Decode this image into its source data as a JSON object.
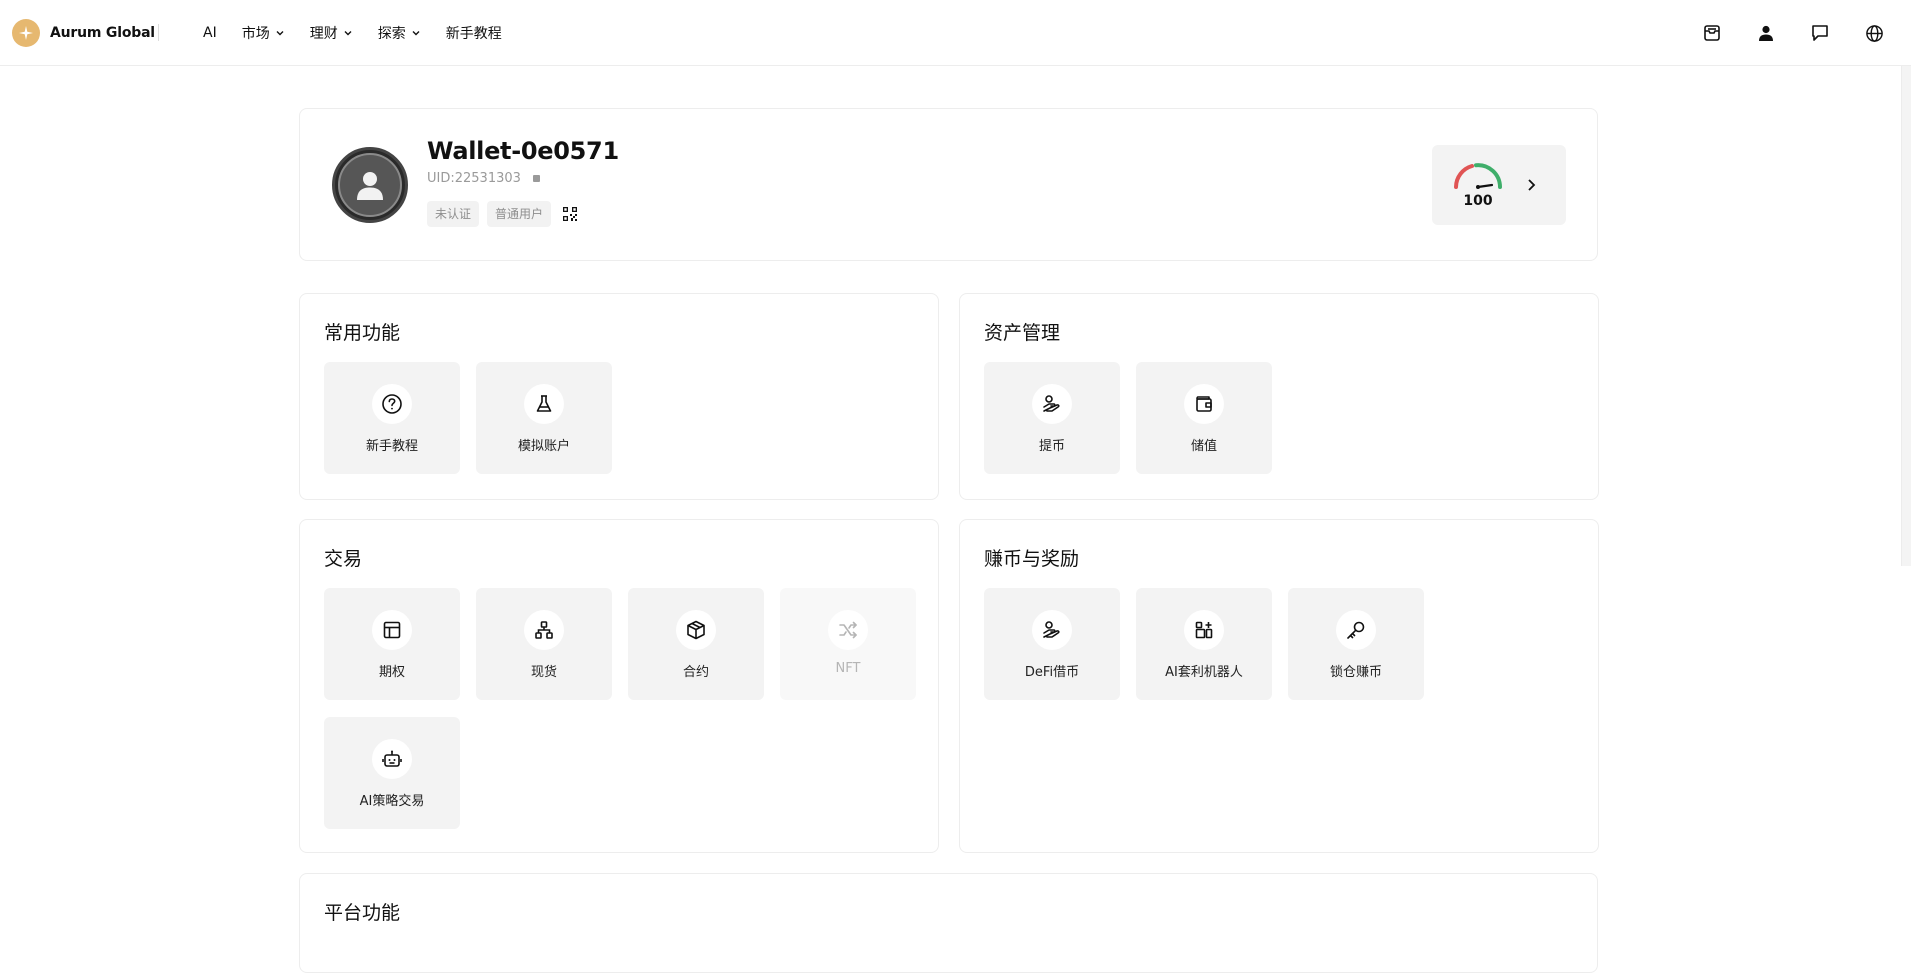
{
  "brand": {
    "name": "Aurum Global",
    "logo_icon": "sparkle-icon",
    "accent_color": "#e6b870"
  },
  "nav": {
    "items": [
      {
        "label": "AI",
        "has_dropdown": false
      },
      {
        "label": "市场",
        "has_dropdown": true
      },
      {
        "label": "理财",
        "has_dropdown": true
      },
      {
        "label": "探索",
        "has_dropdown": true
      },
      {
        "label": "新手教程",
        "has_dropdown": false
      }
    ]
  },
  "header_icons": [
    "inbox-icon",
    "user-icon",
    "chat-icon",
    "globe-icon"
  ],
  "profile": {
    "wallet_name": "Wallet-0e0571",
    "uid": "UID:22531303",
    "tags": [
      "未认证",
      "普通用户"
    ],
    "score": "100",
    "score_colors": {
      "low": "#e05454",
      "high": "#3fae6a"
    }
  },
  "sections": {
    "common": {
      "title": "常用功能",
      "tiles": [
        {
          "label": "新手教程",
          "icon": "question-circle-icon"
        },
        {
          "label": "模拟账户",
          "icon": "flask-icon"
        }
      ]
    },
    "assets": {
      "title": "资产管理",
      "tiles": [
        {
          "label": "提币",
          "icon": "hand-coin-icon"
        },
        {
          "label": "储值",
          "icon": "wallet-icon"
        }
      ]
    },
    "trade": {
      "title": "交易",
      "tiles": [
        {
          "label": "期权",
          "icon": "layout-icon"
        },
        {
          "label": "现货",
          "icon": "network-icon"
        },
        {
          "label": "合约",
          "icon": "cube-icon"
        },
        {
          "label": "NFT",
          "icon": "shuffle-icon",
          "disabled": true
        },
        {
          "label": "AI策略交易",
          "icon": "robot-icon"
        }
      ]
    },
    "earn": {
      "title": "赚币与奖励",
      "tiles": [
        {
          "label": "DeFi借币",
          "icon": "hand-coin-icon"
        },
        {
          "label": "AI套利机器人",
          "icon": "apps-add-icon"
        },
        {
          "label": "锁仓赚币",
          "icon": "key-icon"
        }
      ]
    },
    "platform": {
      "title": "平台功能"
    }
  }
}
